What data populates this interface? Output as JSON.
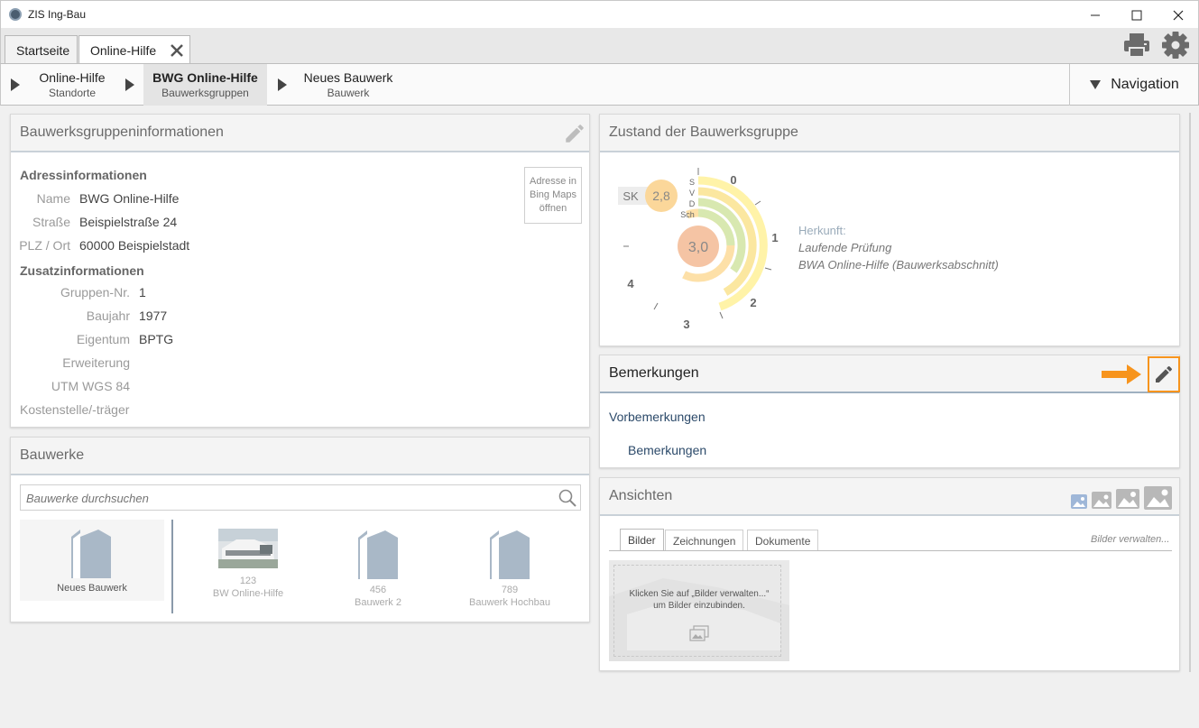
{
  "window": {
    "title": "ZIS Ing-Bau"
  },
  "tabs": [
    {
      "label": "Startseite"
    },
    {
      "label": "Online-Hilfe"
    }
  ],
  "breadcrumbs": [
    {
      "title": "Online-Hilfe",
      "subtitle": "Standorte"
    },
    {
      "title": "BWG Online-Hilfe",
      "subtitle": "Bauwerksgruppen"
    },
    {
      "title": "Neues Bauwerk",
      "subtitle": "Bauwerk"
    }
  ],
  "navigation": {
    "label": "Navigation"
  },
  "info_panel": {
    "title": "Bauwerksgruppeninformationen",
    "map_button": "Adresse in Bing Maps öffnen",
    "address_heading": "Adressinformationen",
    "address": [
      {
        "label": "Name",
        "value": "BWG Online-Hilfe"
      },
      {
        "label": "Straße",
        "value": "Beispielstraße 24"
      },
      {
        "label": "PLZ / Ort",
        "value": "60000 Beispielstadt"
      }
    ],
    "extra_heading": "Zusatzinformationen",
    "extra": [
      {
        "label": "Gruppen-Nr.",
        "value": "1"
      },
      {
        "label": "Baujahr",
        "value": "1977"
      },
      {
        "label": "Eigentum",
        "value": "BPTG"
      },
      {
        "label": "Erweiterung",
        "value": ""
      },
      {
        "label": "UTM WGS 84",
        "value": ""
      },
      {
        "label": "Kostenstelle/-träger",
        "value": ""
      }
    ]
  },
  "bauwerke": {
    "title": "Bauwerke",
    "search_placeholder": "Bauwerke durchsuchen",
    "new_label": "Neues Bauwerk",
    "items": [
      {
        "number": "123",
        "name": "BW Online-Hilfe"
      },
      {
        "number": "456",
        "name": "Bauwerk 2"
      },
      {
        "number": "789",
        "name": "Bauwerk Hochbau"
      }
    ]
  },
  "zustand": {
    "title": "Zustand der Bauwerksgruppe",
    "sk_label": "SK",
    "sk_value": "2,8",
    "main_value": "3,0",
    "scale_labels": [
      "0",
      "1",
      "2",
      "3",
      "4"
    ],
    "ring_labels": [
      "S",
      "V",
      "D",
      "Sch"
    ],
    "herkunft_label": "Herkunft:",
    "herkunft_lines": [
      "Laufende Prüfung",
      "BWA Online-Hilfe (Bauwerksabschnitt)"
    ],
    "colors": {
      "s": "#fff3a8",
      "v": "#fbe7a0",
      "d": "#d8e8b0",
      "sch": "#fde0a8",
      "bubble_main": "#f5c4a4",
      "bubble_sk": "#fbd79a"
    }
  },
  "bemerkungen": {
    "title": "Bemerkungen",
    "items": [
      "Vorbemerkungen",
      "Bemerkungen"
    ],
    "arrow_color": "#f7941d"
  },
  "ansichten": {
    "title": "Ansichten",
    "tabs": [
      "Bilder",
      "Zeichnungen",
      "Dokumente"
    ],
    "manage_link": "Bilder verwalten...",
    "hint_line1": "Klicken Sie auf „Bilder verwalten...“",
    "hint_line2": "um Bilder einzubinden."
  }
}
